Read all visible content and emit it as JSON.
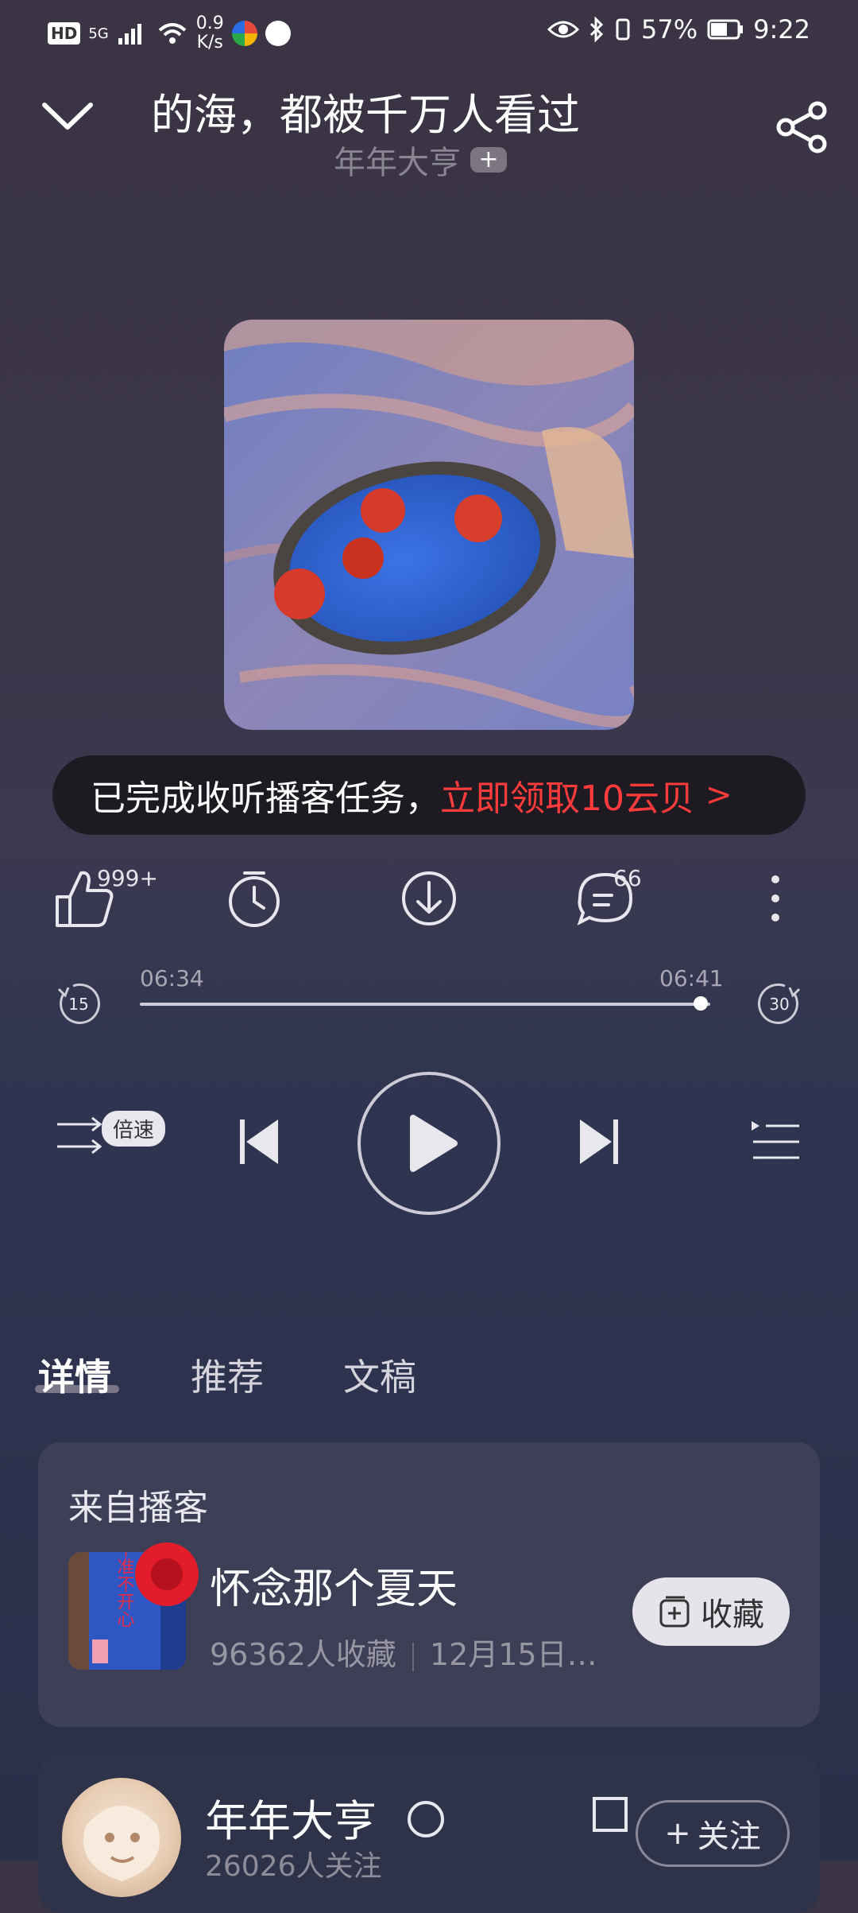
{
  "status_bar": {
    "hd": "HD",
    "network": "5G",
    "speed_value": "0.9",
    "speed_unit": "K/s",
    "battery": "57%",
    "time": "9:22"
  },
  "header": {
    "title": "的海，都被千万人看过",
    "author": "年年大亨",
    "follow_plus": "+"
  },
  "banner": {
    "text": "已完成收听播客任务，",
    "action": "立即领取10云贝",
    "chevron": ">"
  },
  "actions": {
    "like_count": "999+",
    "comment_count": "66"
  },
  "progress": {
    "current": "06:34",
    "total": "06:41",
    "fraction": 0.983,
    "rewind": "15",
    "forward": "30"
  },
  "controls": {
    "speed_label": "倍速"
  },
  "tabs": [
    {
      "label": "详情",
      "active": true
    },
    {
      "label": "推荐",
      "active": false
    },
    {
      "label": "文稿",
      "active": false
    }
  ],
  "podcast_card": {
    "heading": "来自播客",
    "name": "怀念那个夏天",
    "subscribers": "96362人收藏",
    "date": "12月15日…",
    "collect_label": "收藏",
    "cover_text": "不准不开心"
  },
  "author_card": {
    "name": "年年大亨",
    "fans": "26026人关注",
    "follow_label": "关注",
    "follow_plus": "+"
  },
  "colors": {
    "accent_red": "#ff3b3b",
    "record_red": "#e31c2c"
  }
}
